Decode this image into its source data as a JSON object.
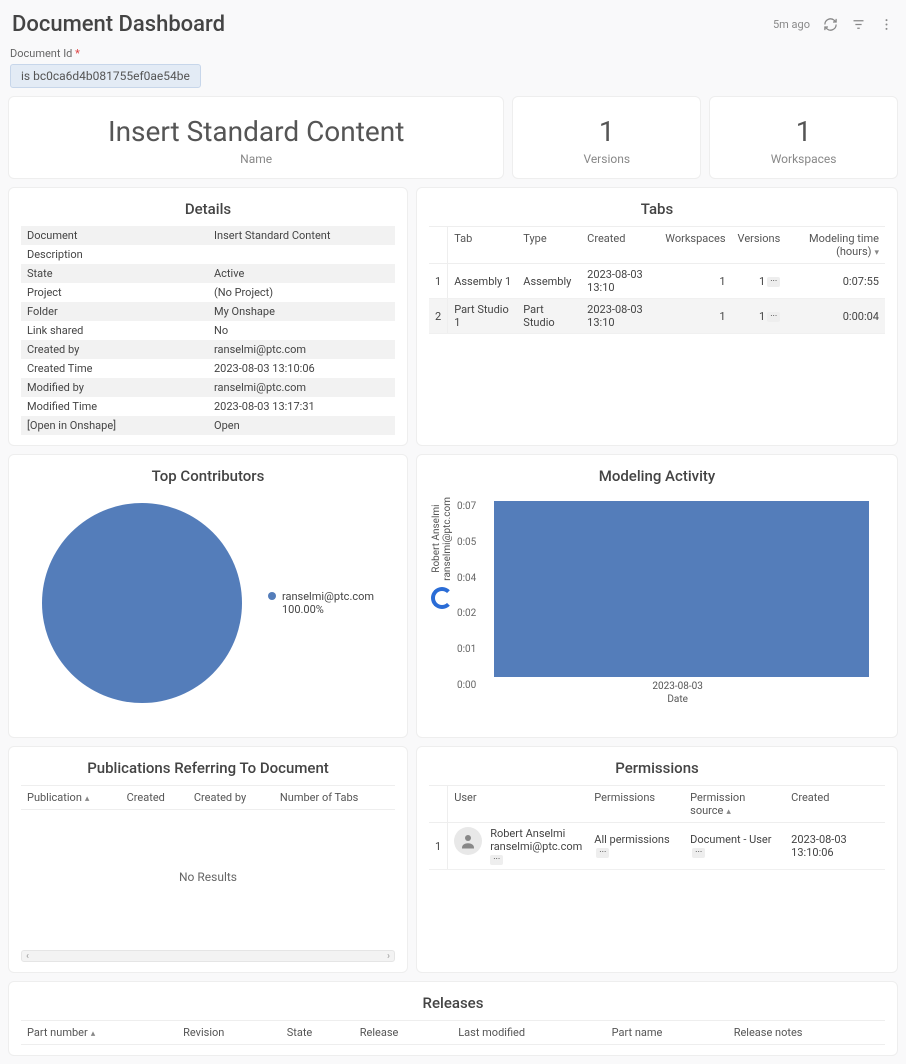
{
  "header": {
    "title": "Document Dashboard",
    "timestamp": "5m ago"
  },
  "filter": {
    "label": "Document Id",
    "required": "*",
    "chip": "is bc0ca6d4b081755ef0ae54be"
  },
  "metrics": {
    "name": {
      "value": "Insert Standard Content",
      "label": "Name"
    },
    "versions": {
      "value": "1",
      "label": "Versions"
    },
    "workspaces": {
      "value": "1",
      "label": "Workspaces"
    }
  },
  "details": {
    "title": "Details",
    "rows": [
      {
        "k": "Document",
        "v": "Insert Standard Content"
      },
      {
        "k": "Description",
        "v": ""
      },
      {
        "k": "State",
        "v": "Active"
      },
      {
        "k": "Project",
        "v": "(No Project)"
      },
      {
        "k": "Folder",
        "v": "My Onshape"
      },
      {
        "k": "Link shared",
        "v": "No"
      },
      {
        "k": "Created by",
        "v": "ranselmi@ptc.com"
      },
      {
        "k": "Created Time",
        "v": "2023-08-03 13:10:06"
      },
      {
        "k": "Modified by",
        "v": "ranselmi@ptc.com"
      },
      {
        "k": "Modified Time",
        "v": "2023-08-03 13:17:31"
      },
      {
        "k": "[Open in Onshape]",
        "v": "Open",
        "link": true
      }
    ]
  },
  "tabs": {
    "title": "Tabs",
    "cols": [
      "Tab",
      "Type",
      "Created",
      "Workspaces",
      "Versions",
      "Modeling time (hours)"
    ],
    "rows": [
      {
        "n": "1",
        "tab": "Assembly 1",
        "type": "Assembly",
        "created": "2023-08-03 13:10",
        "ws": "1",
        "ver": "1",
        "mt": "0:07:55"
      },
      {
        "n": "2",
        "tab": "Part Studio 1",
        "type": "Part Studio",
        "created": "2023-08-03 13:10",
        "ws": "1",
        "ver": "1",
        "mt": "0:00:04"
      }
    ]
  },
  "contributors": {
    "title": "Top Contributors",
    "legend_name": "ranselmi@ptc.com",
    "legend_pct": "100.00%"
  },
  "activity": {
    "title": "Modeling Activity",
    "ylabel": "Robert Anselmi\nranselmi@ptc.com",
    "yticks": [
      "0:07",
      "0:05",
      "0:04",
      "0:02",
      "0:01",
      "0:00"
    ],
    "x": "2023-08-03",
    "xlabel": "Date"
  },
  "publications": {
    "title": "Publications Referring To Document",
    "cols": [
      "Publication",
      "Created",
      "Created by",
      "Number of Tabs"
    ],
    "empty": "No Results"
  },
  "permissions": {
    "title": "Permissions",
    "cols": [
      "User",
      "Permissions",
      "Permission source",
      "Created"
    ],
    "rows": [
      {
        "n": "1",
        "user_name": "Robert Anselmi",
        "user_email": "ranselmi@ptc.com",
        "perm": "All permissions",
        "source": "Document - User",
        "created": "2023-08-03 13:10:06"
      }
    ]
  },
  "releases": {
    "title": "Releases",
    "cols": [
      "Part number",
      "Revision",
      "State",
      "Release",
      "Last modified",
      "Part name",
      "Release notes"
    ]
  },
  "chart_data": [
    {
      "type": "pie",
      "title": "Top Contributors",
      "series": [
        {
          "name": "ranselmi@ptc.com",
          "value": 100.0
        }
      ]
    },
    {
      "type": "bar",
      "title": "Modeling Activity",
      "xlabel": "Date",
      "ylabel": "Robert Anselmi ranselmi@ptc.com",
      "categories": [
        "2023-08-03"
      ],
      "values": [
        0.125
      ],
      "y_unit": "hours",
      "ylim": [
        0,
        0.13
      ],
      "ytick_labels": [
        "0:00",
        "0:01",
        "0:02",
        "0:04",
        "0:05",
        "0:07"
      ]
    }
  ]
}
